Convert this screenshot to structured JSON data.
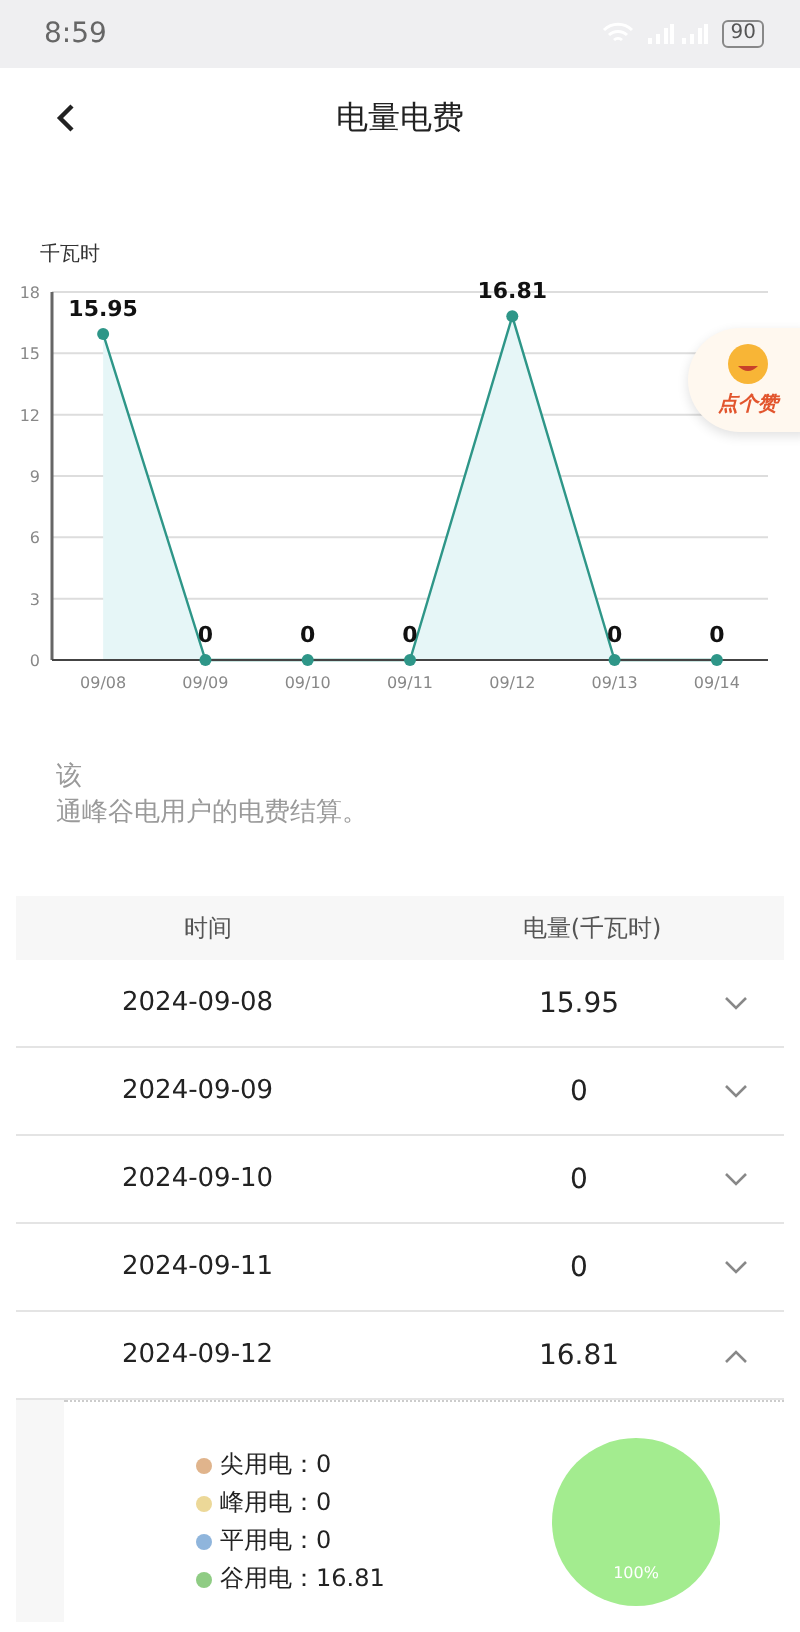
{
  "status_bar": {
    "time": "8:59",
    "battery": "90"
  },
  "nav": {
    "title": "电量电费"
  },
  "usage_chart": {
    "chart_data": {
      "type": "area",
      "ylabel": "千瓦时",
      "categories": [
        "09/08",
        "09/09",
        "09/10",
        "09/11",
        "09/12",
        "09/13",
        "09/14"
      ],
      "grid": true,
      "series": [
        {
          "color": "#2e9688",
          "values": [
            15.95,
            0,
            0,
            0,
            16.81,
            0,
            0
          ]
        }
      ],
      "ylim": [
        0,
        18
      ],
      "yticks": [
        0,
        3,
        6,
        9,
        12,
        15,
        18
      ],
      "data_labels": true
    }
  },
  "like_badge": {
    "label": "点个赞"
  },
  "note": [
    "该",
    "通峰谷电用户的电费结算。"
  ],
  "table": {
    "columns": [
      "时间",
      "电量(千瓦时)"
    ],
    "rows": [
      {
        "date": "2024-09-08",
        "value": "15.95",
        "expanded": false
      },
      {
        "date": "2024-09-09",
        "value": "0",
        "expanded": false
      },
      {
        "date": "2024-09-10",
        "value": "0",
        "expanded": false
      },
      {
        "date": "2024-09-11",
        "value": "0",
        "expanded": false
      },
      {
        "date": "2024-09-12",
        "value": "16.81",
        "expanded": true,
        "breakdown": {
          "legend": [
            {
              "label": "尖用电：",
              "value": "0",
              "color": "#e0b48c"
            },
            {
              "label": "峰用电：",
              "value": "0",
              "color": "#ecd898"
            },
            {
              "label": "平用电：",
              "value": "0",
              "color": "#8fb5dc"
            },
            {
              "label": "谷用电：",
              "value": "16.81",
              "color": "#8fcc84"
            }
          ],
          "chart_data": {
            "type": "pie",
            "values": [
              0,
              0,
              0,
              100
            ],
            "value_labels": [
              null,
              null,
              null,
              "100%"
            ]
          }
        }
      }
    ]
  }
}
